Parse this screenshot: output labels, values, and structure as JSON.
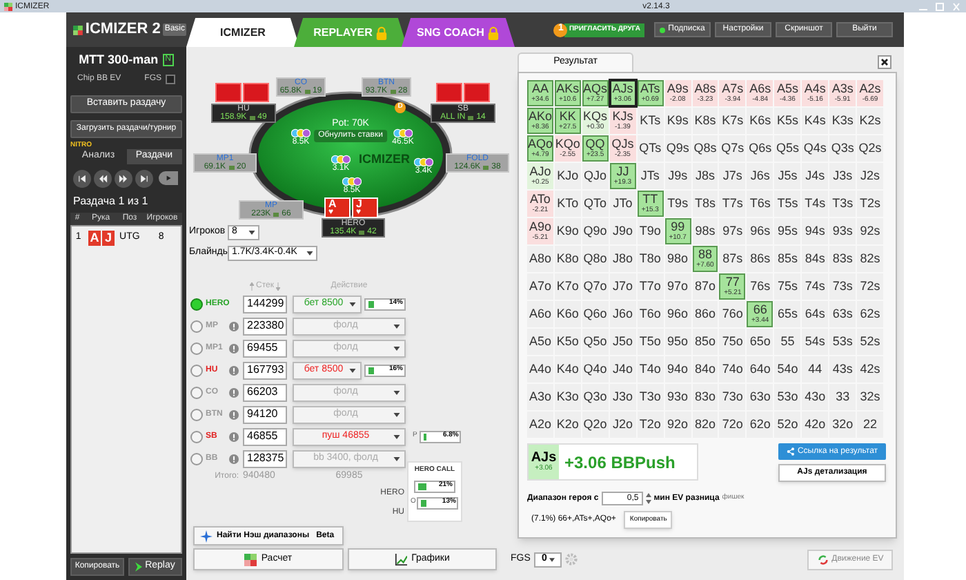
{
  "titlebar": {
    "app": "ICMIZER",
    "version": "v2.14.3"
  },
  "header": {
    "logo": "ICMIZER 2",
    "edition": "Basic",
    "tabs": [
      {
        "label": "ICMIZER",
        "selected": true,
        "locked": false,
        "color": "#ffffff"
      },
      {
        "label": "REPLAYER",
        "selected": false,
        "locked": true,
        "color": "#4cae3a"
      },
      {
        "label": "SNG COACH",
        "selected": false,
        "locked": true,
        "color": "#b048d8"
      }
    ],
    "invite": {
      "badge": "1",
      "label": "ПРИГЛАСИТЬ ДРУГА"
    },
    "buttons": [
      {
        "label": "Подписка",
        "online": true
      },
      {
        "label": "Настройки",
        "online": false
      },
      {
        "label": "Скриншот",
        "online": false
      },
      {
        "label": "Выйти",
        "online": false
      }
    ]
  },
  "sidebar": {
    "tournament": "MTT 300-man",
    "badge": "N",
    "mode": "Chip BB EV",
    "fgs_label": "FGS",
    "fgs_checked": false,
    "buttons": [
      "Вставить раздачу",
      "Загрузить раздачи/турнир"
    ],
    "nitro": "NITRO",
    "tabs": [
      {
        "label": "Анализ",
        "selected": false
      },
      {
        "label": "Раздачи",
        "selected": true
      }
    ],
    "counter": "Раздача 1 из 1",
    "columns": [
      "#",
      "Рука",
      "Поз",
      "Игроков"
    ],
    "hands": [
      {
        "num": "1",
        "cards": [
          "A",
          "J"
        ],
        "position": "UTG",
        "players": "8"
      }
    ],
    "footer_buttons": [
      "Копировать",
      "Replay"
    ]
  },
  "table": {
    "pot": "Pot: 70K",
    "reset_button": "Обнулить ставки",
    "logo": "ICMIZER",
    "antes": "3.1K",
    "dealer": "D",
    "seats": [
      {
        "name": "CO",
        "stack": "65.8K",
        "bb": "19",
        "kind": "empty",
        "folded": true
      },
      {
        "name": "BTN",
        "stack": "93.7K",
        "bb": "28",
        "kind": "empty",
        "folded": true
      },
      {
        "name": "HU",
        "stack": "158.9K",
        "bb": "49",
        "kind": "hidden",
        "folded": false,
        "bet": "8.5K"
      },
      {
        "name": "SB",
        "stack": "ALL IN",
        "bb": "14",
        "kind": "hidden",
        "folded": false,
        "bet": "46.5K"
      },
      {
        "name": "MP1",
        "stack": "69.1K",
        "bb": "20",
        "kind": "empty",
        "folded": true
      },
      {
        "name": "FOLD",
        "stack": "124.6K",
        "bb": "38",
        "kind": "empty",
        "folded": true,
        "bet": "3.4K"
      },
      {
        "name": "MP",
        "stack": "223K",
        "bb": "66",
        "kind": "empty",
        "folded": true
      },
      {
        "name": "HERO",
        "stack": "135.4K",
        "bb": "42",
        "kind": "shown",
        "folded": false,
        "bet": "8.5K",
        "cards": [
          {
            "rank": "A",
            "suit": "♥"
          },
          {
            "rank": "J",
            "suit": "♥"
          }
        ]
      }
    ]
  },
  "settings": {
    "players_label": "Игроков",
    "players_value": "8",
    "blinds_label": "Блайнды",
    "blinds_value": "1.7K/3.4K-0.4K"
  },
  "players": {
    "columns": [
      "Стек",
      "Действие"
    ],
    "rows": [
      {
        "name": "HERO",
        "selected": true,
        "kind": "hero",
        "stack": "144299",
        "action": "бет 8500",
        "meter": {
          "reading": "14%",
          "level": 0.14
        }
      },
      {
        "name": "MP",
        "selected": false,
        "kind": "fold",
        "stack": "223380",
        "action": "фолд"
      },
      {
        "name": "MP1",
        "selected": false,
        "kind": "fold",
        "stack": "69455",
        "action": "фолд"
      },
      {
        "name": "HU",
        "selected": false,
        "kind": "aggressor",
        "stack": "167793",
        "action": "бет 8500",
        "meter": {
          "reading": "16%",
          "level": 0.16
        }
      },
      {
        "name": "CO",
        "selected": false,
        "kind": "fold",
        "stack": "66203",
        "action": "фолд"
      },
      {
        "name": "BTN",
        "selected": false,
        "kind": "fold",
        "stack": "94120",
        "action": "фолд"
      },
      {
        "name": "SB",
        "selected": false,
        "kind": "aggressor",
        "stack": "46855",
        "action": "пуш 46855",
        "side_meter": {
          "label": "P",
          "reading": "6.8%",
          "level": 0.068
        }
      },
      {
        "name": "BB",
        "selected": false,
        "kind": "fold",
        "stack": "128375",
        "action": "bb 3400, фолд"
      }
    ],
    "totals": {
      "label": "Итого:",
      "stack": "940480",
      "action": "69985"
    },
    "hero_call": {
      "title": "HERO CALL",
      "rows": [
        {
          "label": "HERO",
          "reading": "21%",
          "level": 0.21
        },
        {
          "label": "HU",
          "prefix": "O",
          "reading": "13%",
          "level": 0.13
        }
      ]
    }
  },
  "nash_button": {
    "label": "Найти Нэш диапазоны",
    "badge": "Beta"
  },
  "result": {
    "tab": "Результат",
    "matrix": [
      [
        {
          "hand": "AA",
          "ev": "+34.6",
          "kind": "push",
          "selected": false
        },
        {
          "hand": "AKs",
          "ev": "+10.6",
          "kind": "push",
          "selected": false
        },
        {
          "hand": "AQs",
          "ev": "+7.27",
          "kind": "push",
          "selected": false
        },
        {
          "hand": "AJs",
          "ev": "+3.06",
          "kind": "push",
          "selected": true
        },
        {
          "hand": "ATs",
          "ev": "+0.69",
          "kind": "push",
          "selected": false
        },
        {
          "hand": "A9s",
          "ev": "-2.08",
          "kind": "minus",
          "selected": false
        },
        {
          "hand": "A8s",
          "ev": "-3.23",
          "kind": "minus",
          "selected": false
        },
        {
          "hand": "A7s",
          "ev": "-3.94",
          "kind": "minus",
          "selected": false
        },
        {
          "hand": "A6s",
          "ev": "-4.84",
          "kind": "minus",
          "selected": false
        },
        {
          "hand": "A5s",
          "ev": "-4.36",
          "kind": "minus",
          "selected": false
        },
        {
          "hand": "A4s",
          "ev": "-5.16",
          "kind": "minus",
          "selected": false
        },
        {
          "hand": "A3s",
          "ev": "-5.91",
          "kind": "minus",
          "selected": false
        },
        {
          "hand": "A2s",
          "ev": "-6.69",
          "kind": "minus",
          "selected": false
        }
      ],
      [
        {
          "hand": "AKo",
          "ev": "+8.36",
          "kind": "push",
          "selected": false
        },
        {
          "hand": "KK",
          "ev": "+27.5",
          "kind": "push",
          "selected": false
        },
        {
          "hand": "KQs",
          "ev": "+0.30",
          "kind": "plus",
          "selected": false
        },
        {
          "hand": "KJs",
          "ev": "-1.39",
          "kind": "minus",
          "selected": false
        },
        {
          "hand": "KTs",
          "kind": "none",
          "selected": false
        },
        {
          "hand": "K9s",
          "kind": "none",
          "selected": false
        },
        {
          "hand": "K8s",
          "kind": "none",
          "selected": false
        },
        {
          "hand": "K7s",
          "kind": "none",
          "selected": false
        },
        {
          "hand": "K6s",
          "kind": "none",
          "selected": false
        },
        {
          "hand": "K5s",
          "kind": "none",
          "selected": false
        },
        {
          "hand": "K4s",
          "kind": "none",
          "selected": false
        },
        {
          "hand": "K3s",
          "kind": "none",
          "selected": false
        },
        {
          "hand": "K2s",
          "kind": "none",
          "selected": false
        }
      ],
      [
        {
          "hand": "AQo",
          "ev": "+4.79",
          "kind": "push",
          "selected": false
        },
        {
          "hand": "KQo",
          "ev": "-2.55",
          "kind": "minus",
          "selected": false
        },
        {
          "hand": "QQ",
          "ev": "+23.5",
          "kind": "push",
          "selected": false
        },
        {
          "hand": "QJs",
          "ev": "-2.35",
          "kind": "minus",
          "selected": false
        },
        {
          "hand": "QTs",
          "kind": "none",
          "selected": false
        },
        {
          "hand": "Q9s",
          "kind": "none",
          "selected": false
        },
        {
          "hand": "Q8s",
          "kind": "none",
          "selected": false
        },
        {
          "hand": "Q7s",
          "kind": "none",
          "selected": false
        },
        {
          "hand": "Q6s",
          "kind": "none",
          "selected": false
        },
        {
          "hand": "Q5s",
          "kind": "none",
          "selected": false
        },
        {
          "hand": "Q4s",
          "kind": "none",
          "selected": false
        },
        {
          "hand": "Q3s",
          "kind": "none",
          "selected": false
        },
        {
          "hand": "Q2s",
          "kind": "none",
          "selected": false
        }
      ],
      [
        {
          "hand": "AJo",
          "ev": "+0.25",
          "kind": "plus",
          "selected": false
        },
        {
          "hand": "KJo",
          "kind": "none",
          "selected": false
        },
        {
          "hand": "QJo",
          "kind": "none",
          "selected": false
        },
        {
          "hand": "JJ",
          "ev": "+19.3",
          "kind": "push",
          "selected": false
        },
        {
          "hand": "JTs",
          "kind": "none",
          "selected": false
        },
        {
          "hand": "J9s",
          "kind": "none",
          "selected": false
        },
        {
          "hand": "J8s",
          "kind": "none",
          "selected": false
        },
        {
          "hand": "J7s",
          "kind": "none",
          "selected": false
        },
        {
          "hand": "J6s",
          "kind": "none",
          "selected": false
        },
        {
          "hand": "J5s",
          "kind": "none",
          "selected": false
        },
        {
          "hand": "J4s",
          "kind": "none",
          "selected": false
        },
        {
          "hand": "J3s",
          "kind": "none",
          "selected": false
        },
        {
          "hand": "J2s",
          "kind": "none",
          "selected": false
        }
      ],
      [
        {
          "hand": "ATo",
          "ev": "-2.21",
          "kind": "minus",
          "selected": false
        },
        {
          "hand": "KTo",
          "kind": "none",
          "selected": false
        },
        {
          "hand": "QTo",
          "kind": "none",
          "selected": false
        },
        {
          "hand": "JTo",
          "kind": "none",
          "selected": false
        },
        {
          "hand": "TT",
          "ev": "+15.3",
          "kind": "push",
          "selected": false
        },
        {
          "hand": "T9s",
          "kind": "none",
          "selected": false
        },
        {
          "hand": "T8s",
          "kind": "none",
          "selected": false
        },
        {
          "hand": "T7s",
          "kind": "none",
          "selected": false
        },
        {
          "hand": "T6s",
          "kind": "none",
          "selected": false
        },
        {
          "hand": "T5s",
          "kind": "none",
          "selected": false
        },
        {
          "hand": "T4s",
          "kind": "none",
          "selected": false
        },
        {
          "hand": "T3s",
          "kind": "none",
          "selected": false
        },
        {
          "hand": "T2s",
          "kind": "none",
          "selected": false
        }
      ],
      [
        {
          "hand": "A9o",
          "ev": "-5.21",
          "kind": "minus",
          "selected": false
        },
        {
          "hand": "K9o",
          "kind": "none",
          "selected": false
        },
        {
          "hand": "Q9o",
          "kind": "none",
          "selected": false
        },
        {
          "hand": "J9o",
          "kind": "none",
          "selected": false
        },
        {
          "hand": "T9o",
          "kind": "none",
          "selected": false
        },
        {
          "hand": "99",
          "ev": "+10.7",
          "kind": "push",
          "selected": false
        },
        {
          "hand": "98s",
          "kind": "none",
          "selected": false
        },
        {
          "hand": "97s",
          "kind": "none",
          "selected": false
        },
        {
          "hand": "96s",
          "kind": "none",
          "selected": false
        },
        {
          "hand": "95s",
          "kind": "none",
          "selected": false
        },
        {
          "hand": "94s",
          "kind": "none",
          "selected": false
        },
        {
          "hand": "93s",
          "kind": "none",
          "selected": false
        },
        {
          "hand": "92s",
          "kind": "none",
          "selected": false
        }
      ],
      [
        {
          "hand": "A8o",
          "kind": "none",
          "selected": false
        },
        {
          "hand": "K8o",
          "kind": "none",
          "selected": false
        },
        {
          "hand": "Q8o",
          "kind": "none",
          "selected": false
        },
        {
          "hand": "J8o",
          "kind": "none",
          "selected": false
        },
        {
          "hand": "T8o",
          "kind": "none",
          "selected": false
        },
        {
          "hand": "98o",
          "kind": "none",
          "selected": false
        },
        {
          "hand": "88",
          "ev": "+7.60",
          "kind": "push",
          "selected": false
        },
        {
          "hand": "87s",
          "kind": "none",
          "selected": false
        },
        {
          "hand": "86s",
          "kind": "none",
          "selected": false
        },
        {
          "hand": "85s",
          "kind": "none",
          "selected": false
        },
        {
          "hand": "84s",
          "kind": "none",
          "selected": false
        },
        {
          "hand": "83s",
          "kind": "none",
          "selected": false
        },
        {
          "hand": "82s",
          "kind": "none",
          "selected": false
        }
      ],
      [
        {
          "hand": "A7o",
          "kind": "none",
          "selected": false
        },
        {
          "hand": "K7o",
          "kind": "none",
          "selected": false
        },
        {
          "hand": "Q7o",
          "kind": "none",
          "selected": false
        },
        {
          "hand": "J7o",
          "kind": "none",
          "selected": false
        },
        {
          "hand": "T7o",
          "kind": "none",
          "selected": false
        },
        {
          "hand": "97o",
          "kind": "none",
          "selected": false
        },
        {
          "hand": "87o",
          "kind": "none",
          "selected": false
        },
        {
          "hand": "77",
          "ev": "+5.21",
          "kind": "push",
          "selected": false
        },
        {
          "hand": "76s",
          "kind": "none",
          "selected": false
        },
        {
          "hand": "75s",
          "kind": "none",
          "selected": false
        },
        {
          "hand": "74s",
          "kind": "none",
          "selected": false
        },
        {
          "hand": "73s",
          "kind": "none",
          "selected": false
        },
        {
          "hand": "72s",
          "kind": "none",
          "selected": false
        }
      ],
      [
        {
          "hand": "A6o",
          "kind": "none",
          "selected": false
        },
        {
          "hand": "K6o",
          "kind": "none",
          "selected": false
        },
        {
          "hand": "Q6o",
          "kind": "none",
          "selected": false
        },
        {
          "hand": "J6o",
          "kind": "none",
          "selected": false
        },
        {
          "hand": "T6o",
          "kind": "none",
          "selected": false
        },
        {
          "hand": "96o",
          "kind": "none",
          "selected": false
        },
        {
          "hand": "86o",
          "kind": "none",
          "selected": false
        },
        {
          "hand": "76o",
          "kind": "none",
          "selected": false
        },
        {
          "hand": "66",
          "ev": "+3.44",
          "kind": "push",
          "selected": false
        },
        {
          "hand": "65s",
          "kind": "none",
          "selected": false
        },
        {
          "hand": "64s",
          "kind": "none",
          "selected": false
        },
        {
          "hand": "63s",
          "kind": "none",
          "selected": false
        },
        {
          "hand": "62s",
          "kind": "none",
          "selected": false
        }
      ],
      [
        {
          "hand": "A5o",
          "kind": "none",
          "selected": false
        },
        {
          "hand": "K5o",
          "kind": "none",
          "selected": false
        },
        {
          "hand": "Q5o",
          "kind": "none",
          "selected": false
        },
        {
          "hand": "J5o",
          "kind": "none",
          "selected": false
        },
        {
          "hand": "T5o",
          "kind": "none",
          "selected": false
        },
        {
          "hand": "95o",
          "kind": "none",
          "selected": false
        },
        {
          "hand": "85o",
          "kind": "none",
          "selected": false
        },
        {
          "hand": "75o",
          "kind": "none",
          "selected": false
        },
        {
          "hand": "65o",
          "kind": "none",
          "selected": false
        },
        {
          "hand": "55",
          "kind": "none",
          "selected": false
        },
        {
          "hand": "54s",
          "kind": "none",
          "selected": false
        },
        {
          "hand": "53s",
          "kind": "none",
          "selected": false
        },
        {
          "hand": "52s",
          "kind": "none",
          "selected": false
        }
      ],
      [
        {
          "hand": "A4o",
          "kind": "none",
          "selected": false
        },
        {
          "hand": "K4o",
          "kind": "none",
          "selected": false
        },
        {
          "hand": "Q4o",
          "kind": "none",
          "selected": false
        },
        {
          "hand": "J4o",
          "kind": "none",
          "selected": false
        },
        {
          "hand": "T4o",
          "kind": "none",
          "selected": false
        },
        {
          "hand": "94o",
          "kind": "none",
          "selected": false
        },
        {
          "hand": "84o",
          "kind": "none",
          "selected": false
        },
        {
          "hand": "74o",
          "kind": "none",
          "selected": false
        },
        {
          "hand": "64o",
          "kind": "none",
          "selected": false
        },
        {
          "hand": "54o",
          "kind": "none",
          "selected": false
        },
        {
          "hand": "44",
          "kind": "none",
          "selected": false
        },
        {
          "hand": "43s",
          "kind": "none",
          "selected": false
        },
        {
          "hand": "42s",
          "kind": "none",
          "selected": false
        }
      ],
      [
        {
          "hand": "A3o",
          "kind": "none",
          "selected": false
        },
        {
          "hand": "K3o",
          "kind": "none",
          "selected": false
        },
        {
          "hand": "Q3o",
          "kind": "none",
          "selected": false
        },
        {
          "hand": "J3o",
          "kind": "none",
          "selected": false
        },
        {
          "hand": "T3o",
          "kind": "none",
          "selected": false
        },
        {
          "hand": "93o",
          "kind": "none",
          "selected": false
        },
        {
          "hand": "83o",
          "kind": "none",
          "selected": false
        },
        {
          "hand": "73o",
          "kind": "none",
          "selected": false
        },
        {
          "hand": "63o",
          "kind": "none",
          "selected": false
        },
        {
          "hand": "53o",
          "kind": "none",
          "selected": false
        },
        {
          "hand": "43o",
          "kind": "none",
          "selected": false
        },
        {
          "hand": "33",
          "kind": "none",
          "selected": false
        },
        {
          "hand": "32s",
          "kind": "none",
          "selected": false
        }
      ],
      [
        {
          "hand": "A2o",
          "kind": "none",
          "selected": false
        },
        {
          "hand": "K2o",
          "kind": "none",
          "selected": false
        },
        {
          "hand": "Q2o",
          "kind": "none",
          "selected": false
        },
        {
          "hand": "J2o",
          "kind": "none",
          "selected": false
        },
        {
          "hand": "T2o",
          "kind": "none",
          "selected": false
        },
        {
          "hand": "92o",
          "kind": "none",
          "selected": false
        },
        {
          "hand": "82o",
          "kind": "none",
          "selected": false
        },
        {
          "hand": "72o",
          "kind": "none",
          "selected": false
        },
        {
          "hand": "62o",
          "kind": "none",
          "selected": false
        },
        {
          "hand": "52o",
          "kind": "none",
          "selected": false
        },
        {
          "hand": "42o",
          "kind": "none",
          "selected": false
        },
        {
          "hand": "32o",
          "kind": "none",
          "selected": false
        },
        {
          "hand": "22",
          "kind": "none",
          "selected": false
        }
      ]
    ],
    "summary": {
      "hand": "AJs",
      "ev": "+3.06",
      "result": "+3.06 BBPush"
    },
    "link_button": "Ссылка на результат",
    "detail_button": "AJs детализация",
    "range_label": "Диапазон героя с",
    "range_value": "0,5",
    "min_label": "мин EV разница",
    "unit": "фишек",
    "range_text": "(7.1%) 66+,ATs+,AQo+",
    "copy_button": "Копировать"
  },
  "bottom": {
    "calc_button": "Расчет",
    "charts_button": "Графики",
    "fgs_label": "FGS",
    "fgs_value": "0",
    "ev_button": "Движение EV"
  }
}
